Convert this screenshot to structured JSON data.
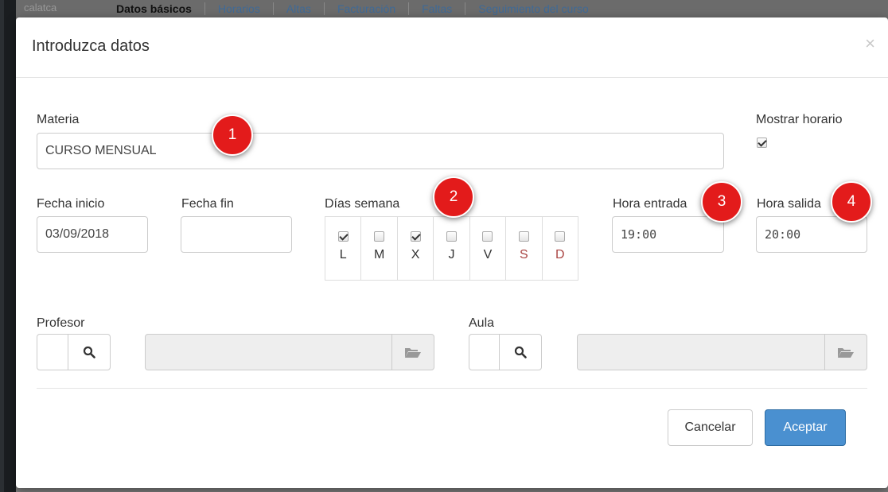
{
  "background": {
    "tabs": [
      "Datos básicos",
      "Horarios",
      "Altas",
      "Facturación",
      "Faltas",
      "Seguimiento del curso"
    ],
    "ghost_text": "calatca"
  },
  "modal": {
    "title": "Introduzca datos",
    "close_symbol": "×"
  },
  "form": {
    "materia": {
      "label": "Materia",
      "value": "CURSO MENSUAL"
    },
    "mostrar_horario": {
      "label": "Mostrar horario",
      "checked": true
    },
    "fecha_inicio": {
      "label": "Fecha inicio",
      "value": "03/09/2018"
    },
    "fecha_fin": {
      "label": "Fecha fin",
      "value": ""
    },
    "dias_semana": {
      "label": "Días semana",
      "days": [
        {
          "letter": "L",
          "checked": true
        },
        {
          "letter": "M",
          "checked": false
        },
        {
          "letter": "X",
          "checked": true
        },
        {
          "letter": "J",
          "checked": false
        },
        {
          "letter": "V",
          "checked": false
        },
        {
          "letter": "S",
          "checked": false,
          "weekend": true
        },
        {
          "letter": "D",
          "checked": false,
          "weekend": true
        }
      ]
    },
    "hora_entrada": {
      "label": "Hora entrada",
      "value": "19:00"
    },
    "hora_salida": {
      "label": "Hora salida",
      "value": "20:00"
    },
    "profesor": {
      "label": "Profesor"
    },
    "aula": {
      "label": "Aula"
    }
  },
  "badges": [
    "1",
    "2",
    "3",
    "4"
  ],
  "footer": {
    "cancel_label": "Cancelar",
    "accept_label": "Aceptar"
  },
  "colors": {
    "primary": "#4a90d0",
    "badge": "#e31b1b",
    "weekend": "#a94442"
  }
}
